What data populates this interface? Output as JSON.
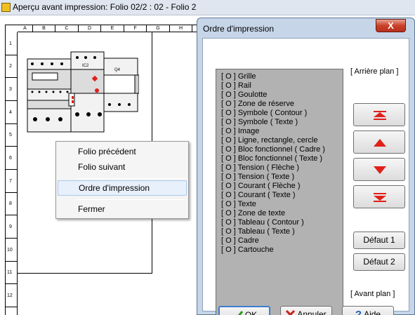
{
  "background_window": {
    "title": "Aperçu avant impression: Folio 02/2 : 02 - Folio 2",
    "columns": [
      "A",
      "B",
      "C",
      "D",
      "E",
      "F",
      "G",
      "H"
    ],
    "rows": [
      "1",
      "2",
      "3",
      "4",
      "5",
      "6",
      "7",
      "8",
      "9",
      "10",
      "11",
      "12"
    ],
    "drawing_labels": {
      "ic2": "IC2",
      "q4": "Q4"
    }
  },
  "context_menu": {
    "items": [
      {
        "label": "Folio précédent"
      },
      {
        "label": "Folio suivant"
      },
      {
        "label": "Ordre d'impression"
      },
      {
        "label": "Fermer"
      }
    ]
  },
  "dialog": {
    "title": "Ordre d'impression",
    "close_label": "X",
    "back_label": "[ Arrière plan ]",
    "front_label": "[ Avant plan ]",
    "list": [
      "[ O ]  Grille",
      "[ O ]  Rail",
      "[ O ]  Goulotte",
      "[ O ]  Zone de réserve",
      "[ O ]  Symbole ( Contour )",
      "[ O ]  Symbole ( Texte )",
      "[ O ]  Image",
      "[ O ]  Ligne, rectangle, cercle",
      "[ O ]  Bloc fonctionnel ( Cadre )",
      "[ O ]  Bloc fonctionnel ( Texte )",
      "[ O ]  Tension ( Flèche )",
      "[ O ]  Tension ( Texte )",
      "[ O ]  Courant  ( Flèche )",
      "[ O ]  Courant ( Texte )",
      "[ O ]  Texte",
      "[ O ]  Zone de texte",
      "[ O ]  Tableau ( Contour )",
      "[ O ]  Tableau ( Texte )",
      "[ O ]  Cadre",
      "[ O ]  Cartouche"
    ],
    "buttons": {
      "default1": "Défaut 1",
      "default2": "Défaut 2",
      "ok": "OK",
      "cancel": "Annuler",
      "help": "Aide"
    },
    "arrow_color": "#e0201a"
  }
}
